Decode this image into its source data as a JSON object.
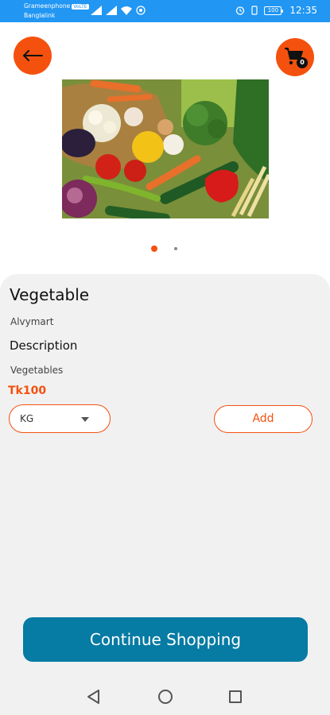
{
  "status_bar": {
    "carrier_line1": "Grameenphone",
    "volte": "VoLTE",
    "carrier_line2": "Banglalink",
    "battery": "100",
    "time": "12:35"
  },
  "header": {
    "back_icon": "arrow-left-icon",
    "cart_icon": "cart-icon",
    "cart_count": "0"
  },
  "product": {
    "image_subject": "vegetables-basket-image",
    "carousel_active_index": 0,
    "carousel_count": 2,
    "name": "Vegetable",
    "store": "Alvymart",
    "description_label": "Description",
    "description": "Vegetables",
    "price": "Tk100",
    "unit_selected": "KG",
    "add_label": "Add"
  },
  "footer": {
    "continue_label": "Continue Shopping"
  },
  "colors": {
    "accent": "#F4510F",
    "primary_button": "#067BA4",
    "status_bar": "#2196F3",
    "card_bg": "#F1F1F1"
  }
}
